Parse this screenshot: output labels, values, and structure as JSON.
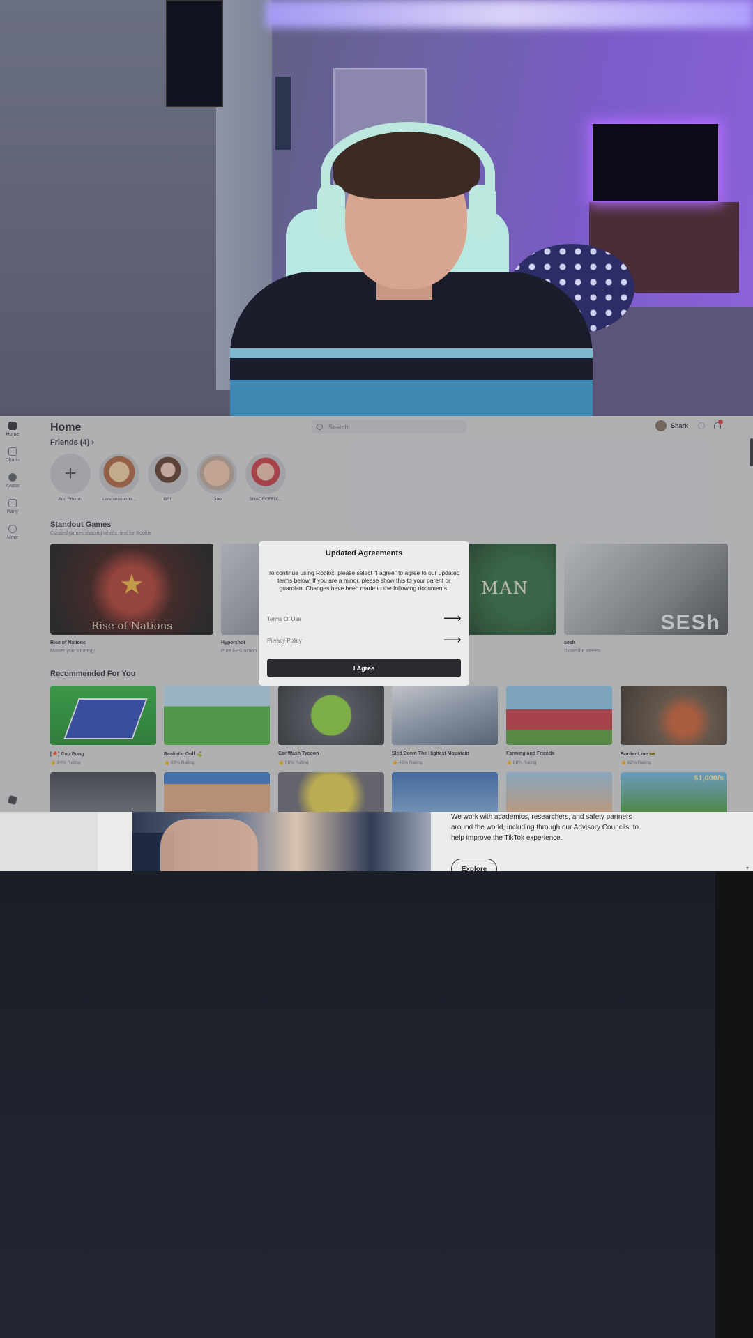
{
  "roblox": {
    "sidebar": [
      {
        "label": "Home",
        "icon": "home-icon"
      },
      {
        "label": "Charts",
        "icon": "charts-icon"
      },
      {
        "label": "Avatar",
        "icon": "avatar-icon"
      },
      {
        "label": "Party",
        "icon": "party-icon"
      },
      {
        "label": "More",
        "icon": "more-icon"
      }
    ],
    "page_title": "Home",
    "search_placeholder": "Search",
    "username": "Shark",
    "friends_label": "Friends (4)",
    "friends": [
      "Add Friends",
      "Landonsounds...",
      "BSL",
      "Dino",
      "SHADEOFFIX..."
    ],
    "standout": {
      "title": "Standout Games",
      "subtitle": "Curated games shaping what's next for Roblox",
      "games": [
        {
          "name": "Rise of Nations",
          "desc": "Master your strategy",
          "logo": "Rise of Nations"
        },
        {
          "name": "Hypershot",
          "desc": "Pure FPS action"
        },
        {
          "logo": "MAN"
        },
        {
          "name": "sesh",
          "desc": "Skate the streets",
          "logo": "SESh"
        }
      ]
    },
    "recommended": {
      "title": "Recommended For You",
      "games": [
        {
          "name": "[🏓] Cup Pong",
          "rating": "84% Rating"
        },
        {
          "name": "Realistic Golf ⛳",
          "rating": "69% Rating"
        },
        {
          "name": "Car Wash Tycoon",
          "rating": "58% Rating"
        },
        {
          "name": "Sled Down The Highest Mountain",
          "rating": "45% Rating"
        },
        {
          "name": "Farming and Friends",
          "rating": "88% Rating"
        },
        {
          "name": "Border Line 🚧",
          "rating": "82% Rating"
        }
      ],
      "second_row_price": "$1,000/s"
    },
    "modal": {
      "title": "Updated Agreements",
      "body": "To continue using Roblox, please select \"I agree\" to agree to our updated terms below. If you are a minor, please show this to your parent or guardian. Changes have been made to the following documents:",
      "links": [
        "Terms Of Use",
        "Privacy Policy"
      ],
      "button": "I Agree"
    }
  },
  "tiktok": {
    "text": "We work with academics, researchers, and safety partners around the world, including through our Advisory Councils, to help improve the TikTok experience.",
    "button": "Explore"
  },
  "colors": {
    "modal_button": "#2a2b2e",
    "notification": "#e0393e",
    "app_bg": "#d6d7d8"
  }
}
